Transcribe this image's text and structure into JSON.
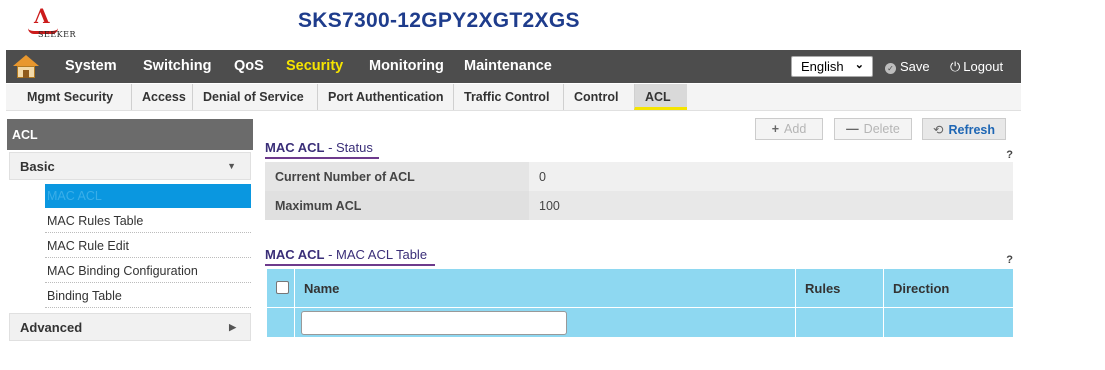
{
  "header": {
    "logo_text": "SEEKER",
    "model": "SKS7300-12GPY2XGT2XGS"
  },
  "nav": {
    "items": [
      {
        "label": "System"
      },
      {
        "label": "Switching"
      },
      {
        "label": "QoS"
      },
      {
        "label": "Security",
        "active": true
      },
      {
        "label": "Monitoring"
      },
      {
        "label": "Maintenance"
      }
    ],
    "language": "English",
    "save_label": "Save",
    "logout_label": "Logout"
  },
  "subnav": {
    "tabs": [
      {
        "label": "Mgmt Security"
      },
      {
        "label": "Access"
      },
      {
        "label": "Denial of Service"
      },
      {
        "label": "Port Authentication"
      },
      {
        "label": "Traffic Control"
      },
      {
        "label": "Control"
      },
      {
        "label": "ACL",
        "active": true
      }
    ]
  },
  "sidebar": {
    "title": "ACL",
    "groups": [
      {
        "label": "Basic",
        "expanded": true
      },
      {
        "label": "Advanced",
        "expanded": false
      }
    ],
    "items": [
      {
        "label": "MAC ACL",
        "selected": true
      },
      {
        "label": "MAC Rules Table"
      },
      {
        "label": "MAC Rule Edit"
      },
      {
        "label": "MAC Binding Configuration"
      },
      {
        "label": "Binding Table"
      }
    ]
  },
  "toolbar": {
    "add_label": "Add",
    "delete_label": "Delete",
    "refresh_label": "Refresh"
  },
  "status_section": {
    "title_bold": "MAC ACL",
    "title_rest": " - Status",
    "help": "?",
    "rows": [
      {
        "key": "Current Number of ACL",
        "value": "0"
      },
      {
        "key": "Maximum ACL",
        "value": "100"
      }
    ]
  },
  "table_section": {
    "title_bold": "MAC ACL",
    "title_rest": " - MAC ACL Table",
    "help": "?",
    "columns": [
      "Name",
      "Rules",
      "Direction"
    ],
    "new_row_name_value": ""
  },
  "colors": {
    "nav_bg": "#4d4d4d",
    "active_nav": "#f5e400",
    "sidebar_selected": "#0a97e0",
    "table_bg": "#8ed8f1",
    "title_blue": "#1e3c8c"
  }
}
